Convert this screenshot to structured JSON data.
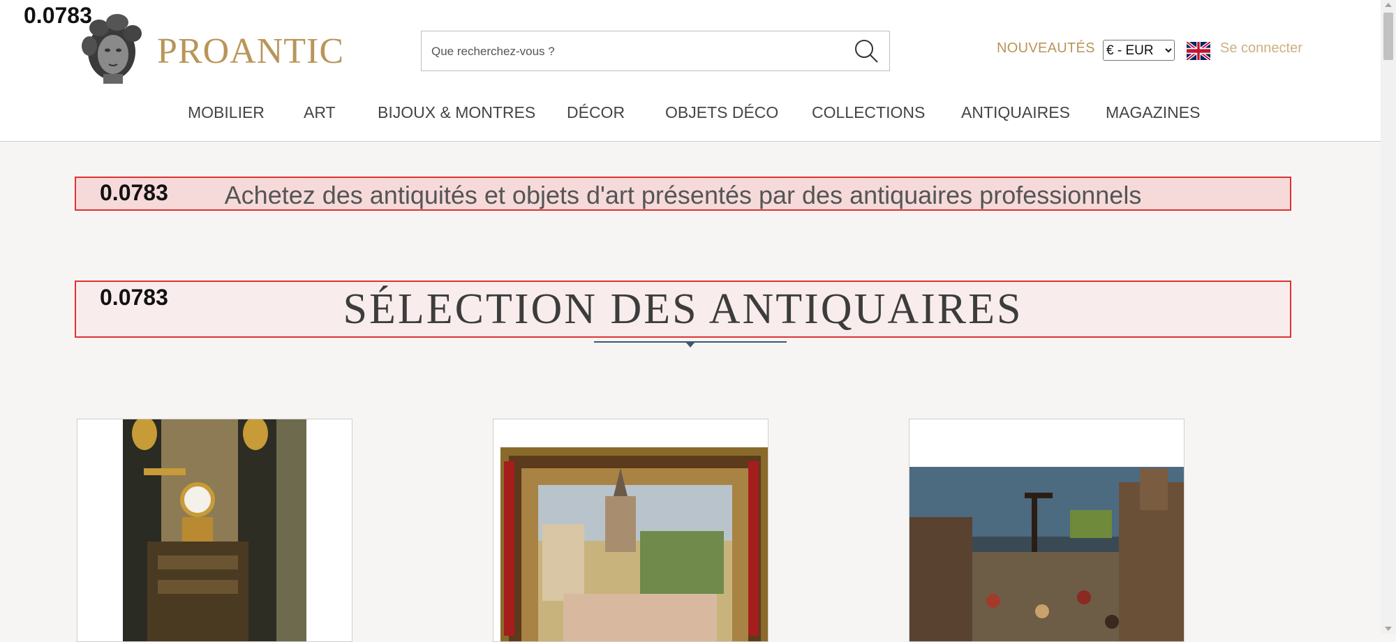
{
  "debug": {
    "score_top": "0.0783",
    "score_tagline": "0.0783",
    "score_selection": "0.0783"
  },
  "brand": {
    "name": "PROANTIC",
    "color": "#b99559"
  },
  "search": {
    "placeholder": "Que recherchez-vous ?",
    "value": ""
  },
  "header": {
    "nouveautes": "NOUVEAUTÉS",
    "currency_selected": "€ - EUR",
    "login": "Se connecter",
    "flag_icon": "uk-flag-icon"
  },
  "nav": {
    "items": [
      "MOBILIER",
      "ART",
      "BIJOUX & MONTRES",
      "DÉCOR",
      "OBJETS DÉCO",
      "COLLECTIONS",
      "ANTIQUAIRES",
      "MAGAZINES"
    ]
  },
  "main": {
    "tagline": "Achetez des antiquités et objets d'art présentés par des antiquaires professionnels",
    "section_title": "SÉLECTION DES ANTIQUAIRES"
  },
  "colors": {
    "accent_red": "#e03131",
    "nav_text": "#444444",
    "background": "#f6f5f3"
  }
}
